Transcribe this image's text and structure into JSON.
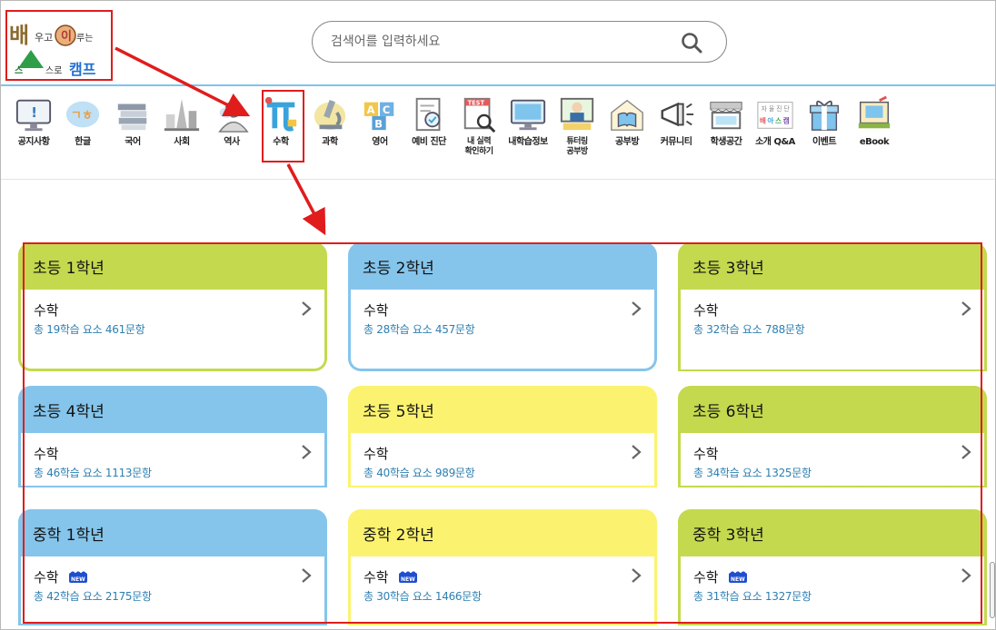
{
  "logo": {
    "line1a": "배",
    "line1b": "우고",
    "line1c": "이",
    "line1d": "루는",
    "line2a": "스",
    "line2b": "스로",
    "line2c": "캠프"
  },
  "search": {
    "placeholder": "검색어를 입력하세요"
  },
  "nav": [
    {
      "label": "공지사항",
      "icon": "notice-monitor-icon"
    },
    {
      "label": "한글",
      "icon": "hangul-icon"
    },
    {
      "label": "국어",
      "icon": "books-icon"
    },
    {
      "label": "사회",
      "icon": "landmarks-icon"
    },
    {
      "label": "역사",
      "icon": "historical-figure-icon"
    },
    {
      "label": "수학",
      "icon": "pi-icon"
    },
    {
      "label": "과학",
      "icon": "microscope-icon"
    },
    {
      "label": "영어",
      "icon": "abc-blocks-icon"
    },
    {
      "label": "예비 진단",
      "icon": "diagnosis-doc-icon"
    },
    {
      "label": "내 실력\n확인하기",
      "icon": "test-magnifier-icon"
    },
    {
      "label": "내학습정보",
      "icon": "computer-icon"
    },
    {
      "label": "튜터링\n공부방",
      "icon": "tutor-icon"
    },
    {
      "label": "공부방",
      "icon": "house-book-icon"
    },
    {
      "label": "커뮤니티",
      "icon": "megaphone-icon"
    },
    {
      "label": "학생공간",
      "icon": "store-icon"
    },
    {
      "label": "소개 Q&A",
      "icon": "intro-sign-icon"
    },
    {
      "label": "이벤트",
      "icon": "gift-icon"
    },
    {
      "label": "eBook",
      "icon": "ebook-icon"
    }
  ],
  "new_badge": "NEW",
  "grades": [
    {
      "name": "초등 1학년",
      "subject": "수학",
      "info": "총 19학습 요소 461문항",
      "color": "#c4d94e",
      "new": false
    },
    {
      "name": "초등 2학년",
      "subject": "수학",
      "info": "총 28학습 요소 457문항",
      "color": "#85c5ec",
      "new": false
    },
    {
      "name": "초등 3학년",
      "subject": "수학",
      "info": "총 32학습 요소 788문항",
      "color": "#c4d94e",
      "new": false
    },
    {
      "name": "초등 4학년",
      "subject": "수학",
      "info": "총 46학습 요소 1113문항",
      "color": "#85c5ec",
      "new": false
    },
    {
      "name": "초등 5학년",
      "subject": "수학",
      "info": "총 40학습 요소 989문항",
      "color": "#fbf370",
      "new": false
    },
    {
      "name": "초등 6학년",
      "subject": "수학",
      "info": "총 34학습 요소 1325문항",
      "color": "#c4d94e",
      "new": false
    },
    {
      "name": "중학 1학년",
      "subject": "수학",
      "info": "총 42학습 요소 2175문항",
      "color": "#85c5ec",
      "new": true
    },
    {
      "name": "중학 2학년",
      "subject": "수학",
      "info": "총 30학습 요소 1466문항",
      "color": "#fbf370",
      "new": true
    },
    {
      "name": "중학 3학년",
      "subject": "수학",
      "info": "총 31학습 요소 1327문항",
      "color": "#c4d94e",
      "new": true
    }
  ]
}
